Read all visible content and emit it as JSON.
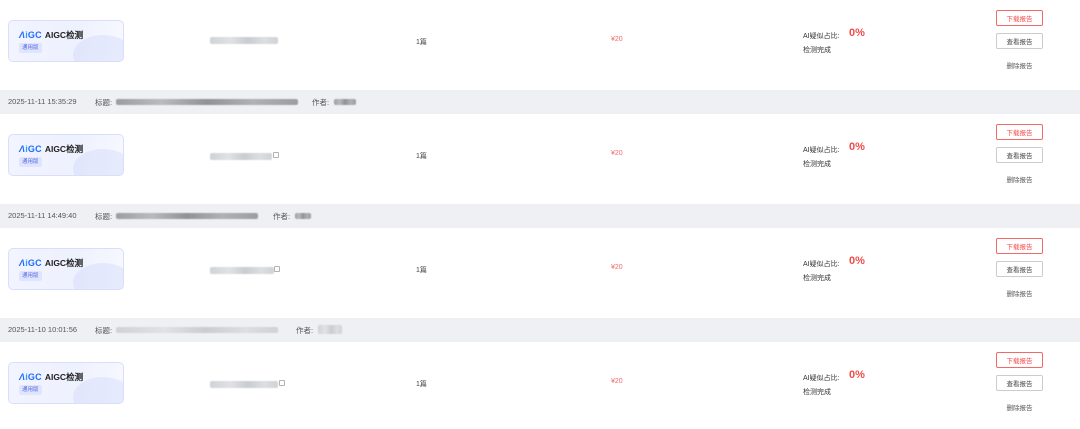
{
  "records": [
    {
      "product_name": "AIGC检测",
      "product_badge": "通用版",
      "count": "1篇",
      "price": "¥20",
      "ai_label": "AI疑似占比:",
      "ai_value": "0%",
      "status": "检测完成",
      "download_label": "下载报告",
      "view_label": "查看报告",
      "delete_label": "删除报告"
    },
    {
      "date": "2025-11-11 15:35:29",
      "title_label": "标题:",
      "author_label": "作者:",
      "product_name": "AIGC检测",
      "product_badge": "通用版",
      "count": "1篇",
      "price": "¥20",
      "ai_label": "AI疑似占比:",
      "ai_value": "0%",
      "status": "检测完成",
      "download_label": "下载报告",
      "view_label": "查看报告",
      "delete_label": "删除报告"
    },
    {
      "date": "2025-11-11 14:49:40",
      "title_label": "标题:",
      "author_label": "作者:",
      "product_name": "AIGC检测",
      "product_badge": "通用版",
      "count": "1篇",
      "price": "¥20",
      "ai_label": "AI疑似占比:",
      "ai_value": "0%",
      "status": "检测完成",
      "download_label": "下载报告",
      "view_label": "查看报告",
      "delete_label": "删除报告"
    },
    {
      "date": "2025-11-10 10:01:56",
      "title_label": "标题:",
      "author_label": "作者:",
      "product_name": "AIGC检测",
      "product_badge": "通用版",
      "count": "1篇",
      "price": "¥20",
      "ai_label": "AI疑似占比:",
      "ai_value": "0%",
      "status": "检测完成",
      "download_label": "下载报告",
      "view_label": "查看报告",
      "delete_label": "删除报告"
    }
  ],
  "logo": {
    "l1": "Λ",
    "l2": "i",
    "l3": "GC"
  },
  "colors": {
    "accent_red": "#f24a4a",
    "brand_blue": "#1f6cff",
    "header_bg": "#eef0f4"
  }
}
